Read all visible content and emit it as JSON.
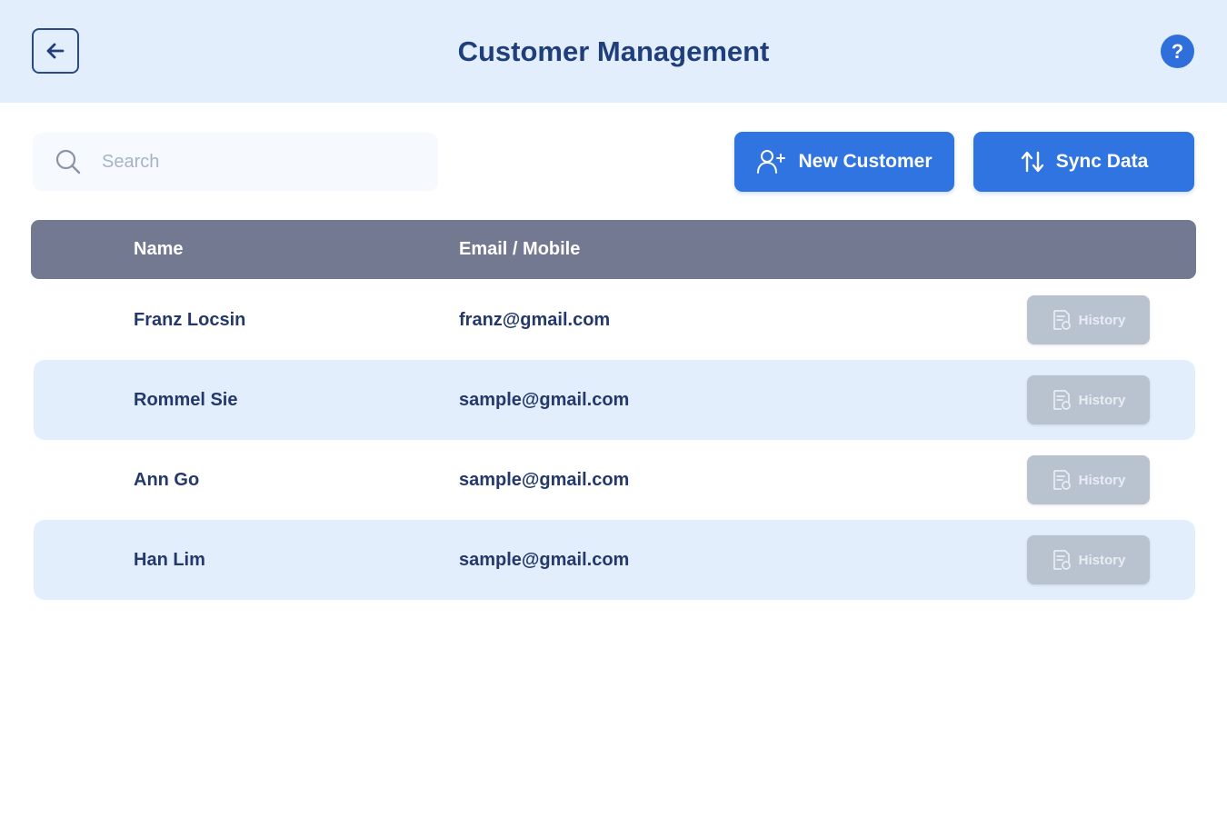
{
  "header": {
    "title": "Customer Management",
    "back_icon": "arrow-left-icon",
    "help_icon": "question-icon",
    "help_glyph": "?"
  },
  "toolbar": {
    "search_placeholder": "Search",
    "search_value": "",
    "new_customer_label": "New Customer",
    "sync_data_label": "Sync Data"
  },
  "table": {
    "columns": [
      "Name",
      "Email / Mobile"
    ],
    "history_label": "History",
    "rows": [
      {
        "name": "Franz Locsin",
        "email": "franz@gmail.com"
      },
      {
        "name": "Rommel Sie",
        "email": "sample@gmail.com"
      },
      {
        "name": "Ann Go",
        "email": "sample@gmail.com"
      },
      {
        "name": "Han Lim",
        "email": "sample@gmail.com"
      }
    ]
  },
  "colors": {
    "header_bg": "#e3eefc",
    "title": "#1f3e7c",
    "accent": "#2f74e0",
    "table_header_bg": "#737991",
    "row_alt_bg": "#e3eefc",
    "history_btn_bg": "#b9c2cf"
  }
}
